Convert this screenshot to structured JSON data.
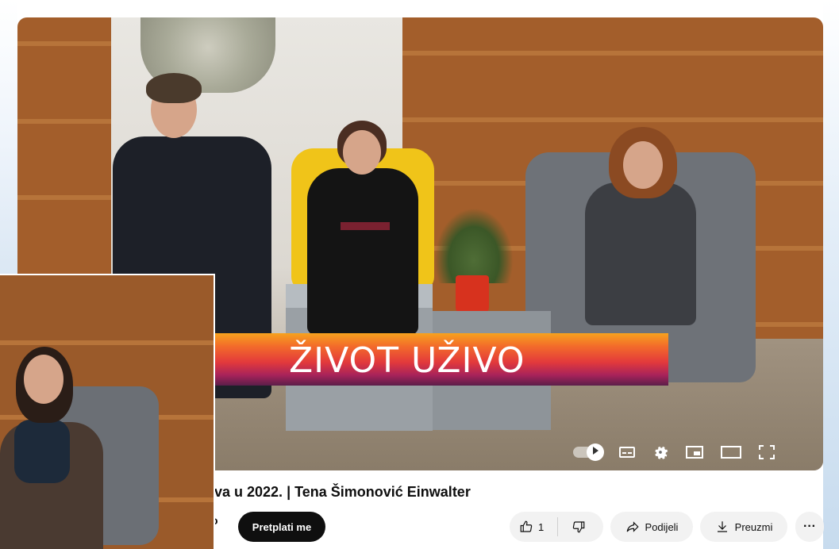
{
  "video": {
    "lower_third": "ŽIVOT UŽIVO",
    "controls": {
      "autoplay": "autoplay-toggle-icon",
      "subtitles": "subtitles-icon",
      "settings": "gear-icon",
      "miniplayer": "miniplayer-icon",
      "theater": "theater-mode-icon",
      "fullscreen": "fullscreen-icon"
    }
  },
  "meta": {
    "title": "va u 2022. | Tena Šimonović Einwalter",
    "channel_fragment": "o",
    "subscribe_label": "Pretplati me"
  },
  "actions": {
    "like_count": "1",
    "share_label": "Podijeli",
    "download_label": "Preuzmi",
    "more_label": "···"
  },
  "colors": {
    "subscribe_bg": "#0f0f0f",
    "pill_bg": "#f2f2f2",
    "banner_top": "#f6a21e",
    "banner_mid": "#e33a3b",
    "banner_bottom": "#5b1e4a"
  }
}
